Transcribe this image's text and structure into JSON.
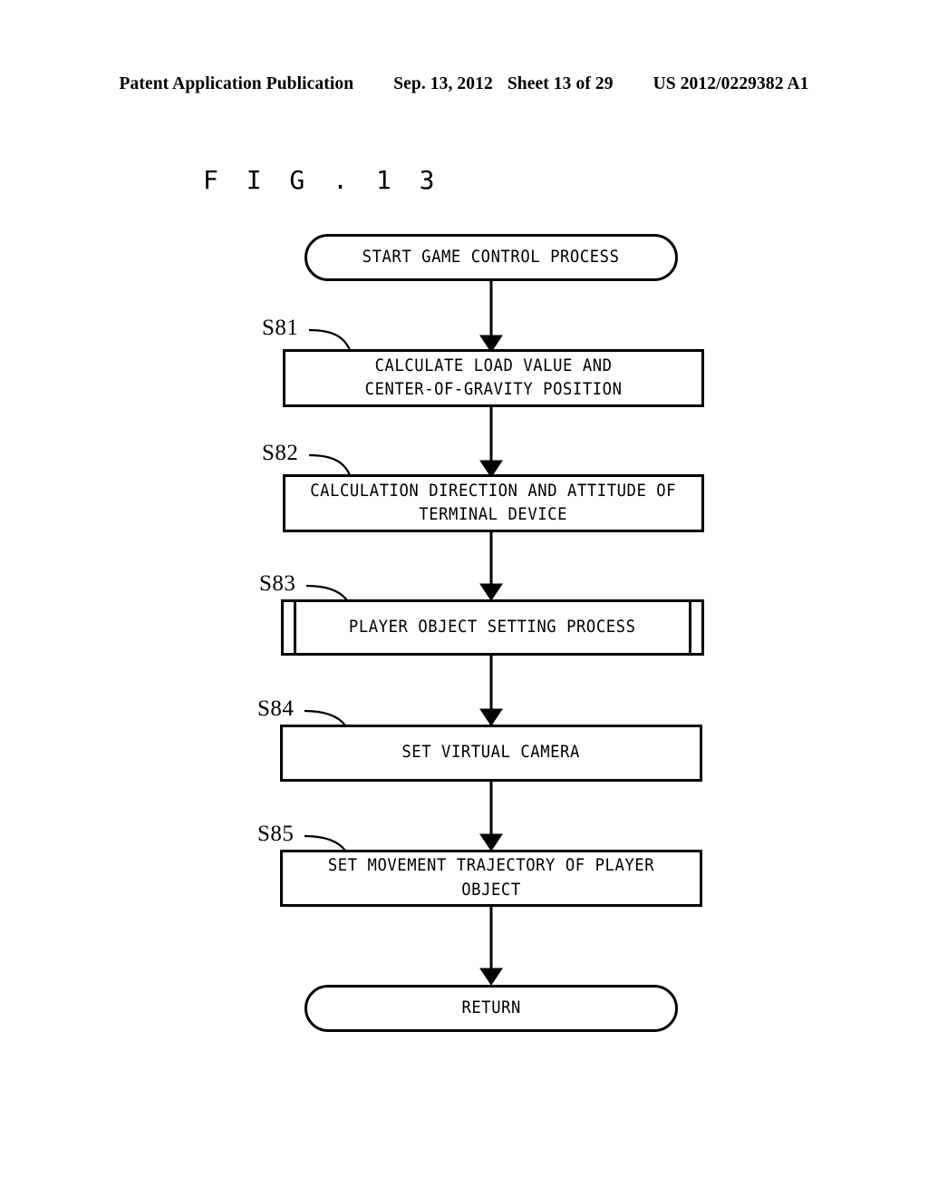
{
  "header": {
    "publication": "Patent Application Publication",
    "date": "Sep. 13, 2012",
    "sheet": "Sheet 13 of 29",
    "document_number": "US 2012/0229382 A1"
  },
  "figure": {
    "title": "F I G .   1 3"
  },
  "flowchart": {
    "start": {
      "label": "START GAME CONTROL PROCESS",
      "shape": "terminal"
    },
    "end": {
      "label": "RETURN",
      "shape": "terminal"
    },
    "steps": [
      {
        "ref": "S81",
        "label": "CALCULATE LOAD VALUE AND\nCENTER-OF-GRAVITY POSITION",
        "shape": "process"
      },
      {
        "ref": "S82",
        "label": "CALCULATION DIRECTION AND ATTITUDE OF\nTERMINAL DEVICE",
        "shape": "process"
      },
      {
        "ref": "S83",
        "label": "PLAYER OBJECT SETTING PROCESS",
        "shape": "subroutine"
      },
      {
        "ref": "S84",
        "label": "SET VIRTUAL CAMERA",
        "shape": "process"
      },
      {
        "ref": "S85",
        "label": "SET MOVEMENT TRAJECTORY OF PLAYER OBJECT",
        "shape": "process"
      }
    ]
  },
  "colors": {
    "ink": "#000000",
    "paper": "#ffffff"
  }
}
